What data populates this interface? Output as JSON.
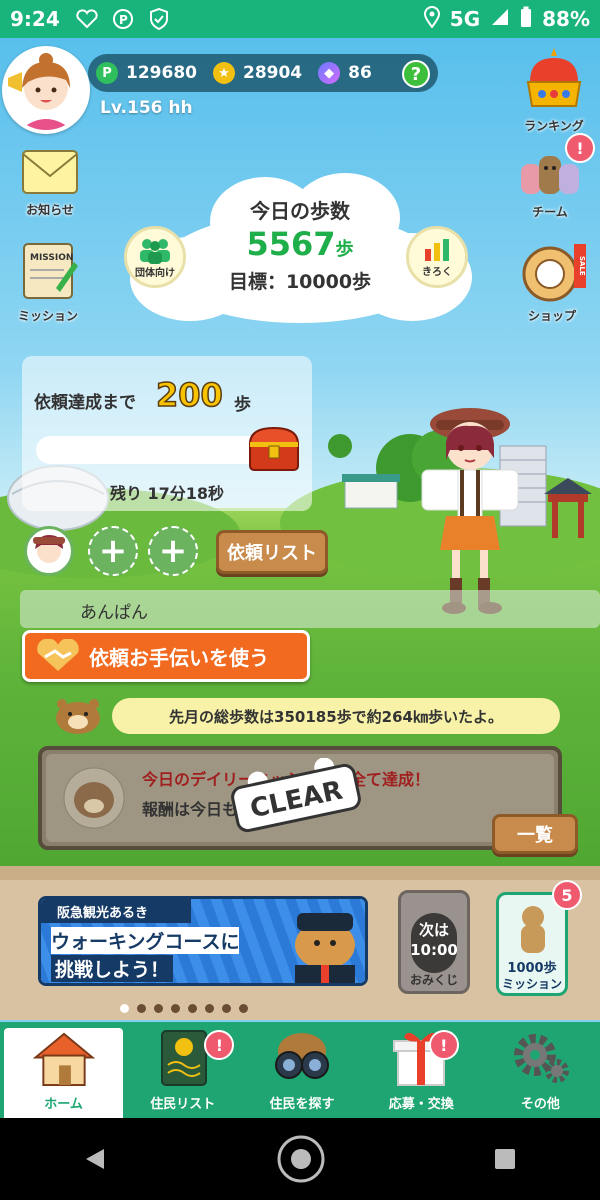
{
  "status": {
    "time": "9:24",
    "network": "5G",
    "battery": "88%"
  },
  "header": {
    "points": "129680",
    "coins": "28904",
    "gems": "86",
    "help": "?",
    "level": "Lv.156 hh"
  },
  "side": {
    "ranking": "ランキング",
    "notice": "お知らせ",
    "team": "チーム",
    "team_badge": "!",
    "mission": "ミッション",
    "mission_sign": "MISSION",
    "shop": "ショップ",
    "shop_sale": "SALE"
  },
  "steps": {
    "title": "今日の歩数",
    "count": "5567",
    "unit": "歩",
    "goal": "目標：10000歩",
    "group_btn": "団体向け",
    "record_btn": "きろく"
  },
  "request": {
    "title": "依頼達成まで",
    "remaining_steps": "200",
    "unit": "歩",
    "time_left": "残り 17分18秒",
    "list_btn": "依頼リスト",
    "plus1": "+",
    "plus2": "+"
  },
  "resident_name": "あんぱん",
  "help_button": "依頼お手伝いを使う",
  "month_message": "先月の総歩数は350185歩で約264㎞歩いたよ。",
  "daily": {
    "line1": "今日のデイリーミッションは全て達成！",
    "line2": "報酬は今日も受け取ろう！",
    "stamp": "CLEAR",
    "list_btn": "一覧"
  },
  "banner": {
    "tag": "阪急観光あるき",
    "line1": "ウォーキングコースに",
    "line2": "挑戦しよう！"
  },
  "omikuji": {
    "next": "次は",
    "time": "10:00",
    "label": "おみくじ"
  },
  "mission1000": {
    "label1": "1000歩",
    "label2": "ミッション",
    "badge": "5"
  },
  "nav": [
    {
      "label": "ホーム",
      "badge": ""
    },
    {
      "label": "住民リスト",
      "badge": "!"
    },
    {
      "label": "住民を探す",
      "badge": ""
    },
    {
      "label": "応募・交換",
      "badge": "!"
    },
    {
      "label": "その他",
      "badge": ""
    }
  ],
  "colors": {
    "brand": "#1ea571",
    "accent": "#f26a20",
    "badge": "#ef5a6e"
  }
}
